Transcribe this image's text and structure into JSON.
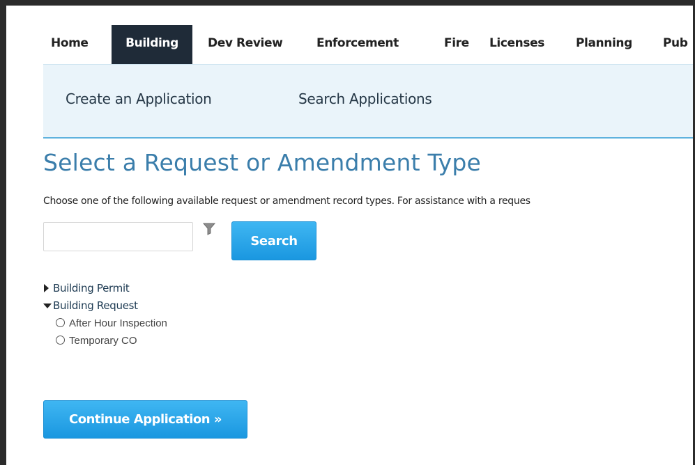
{
  "topnav": {
    "tabs": [
      {
        "label": "Home"
      },
      {
        "label": "Building"
      },
      {
        "label": "Dev Review"
      },
      {
        "label": "Enforcement"
      },
      {
        "label": "Fire"
      },
      {
        "label": "Licenses"
      },
      {
        "label": "Planning"
      },
      {
        "label": "Pub"
      }
    ],
    "active_tab": "Building"
  },
  "subnav": {
    "links": [
      {
        "label": "Create an Application"
      },
      {
        "label": "Search Applications"
      }
    ]
  },
  "page": {
    "title": "Select a Request or Amendment Type",
    "instructions": "Choose one of the following available request or amendment record types. For assistance with a reques"
  },
  "search": {
    "value": "",
    "placeholder": "",
    "button_label": "Search",
    "filter_icon": "funnel-filter-icon"
  },
  "tree": {
    "nodes": [
      {
        "label": "Building Permit",
        "expanded": false,
        "icon": "caret-right-icon"
      },
      {
        "label": "Building Request",
        "expanded": true,
        "icon": "caret-down-icon",
        "children": [
          {
            "label": "After Hour Inspection",
            "selected": false
          },
          {
            "label": "Temporary CO",
            "selected": false
          }
        ]
      }
    ]
  },
  "actions": {
    "continue_label": "Continue Application »"
  },
  "colors": {
    "active_tab_bg": "#1f2b38",
    "subnav_bg": "#eaf4fa",
    "title_color": "#3b7eab",
    "button_blue": "#1a97e0"
  }
}
